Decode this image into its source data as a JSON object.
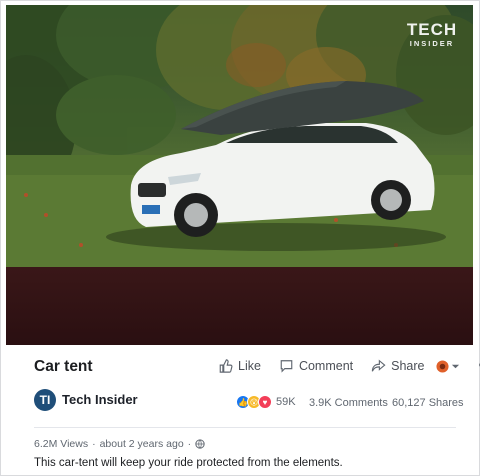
{
  "video": {
    "watermark_line1": "TECH",
    "watermark_line2": "INSIDER"
  },
  "post": {
    "title": "Car tent",
    "actions": {
      "like": "Like",
      "comment": "Comment",
      "share": "Share"
    },
    "publisher": "Tech Insider",
    "publisher_initials": "TI",
    "reaction_count": "59K",
    "comments_count": "3.9K Comments",
    "shares_count": "60,127 Shares",
    "views": "6.2M Views",
    "separator": "·",
    "posted": "about 2 years ago",
    "description": "This car-tent will keep your ride protected from the elements."
  },
  "colors": {
    "like_blue": "#1877f2",
    "wow_yellow": "#f7b928",
    "love_red": "#f33e58",
    "publisher_avatar": "#1f4e79"
  }
}
